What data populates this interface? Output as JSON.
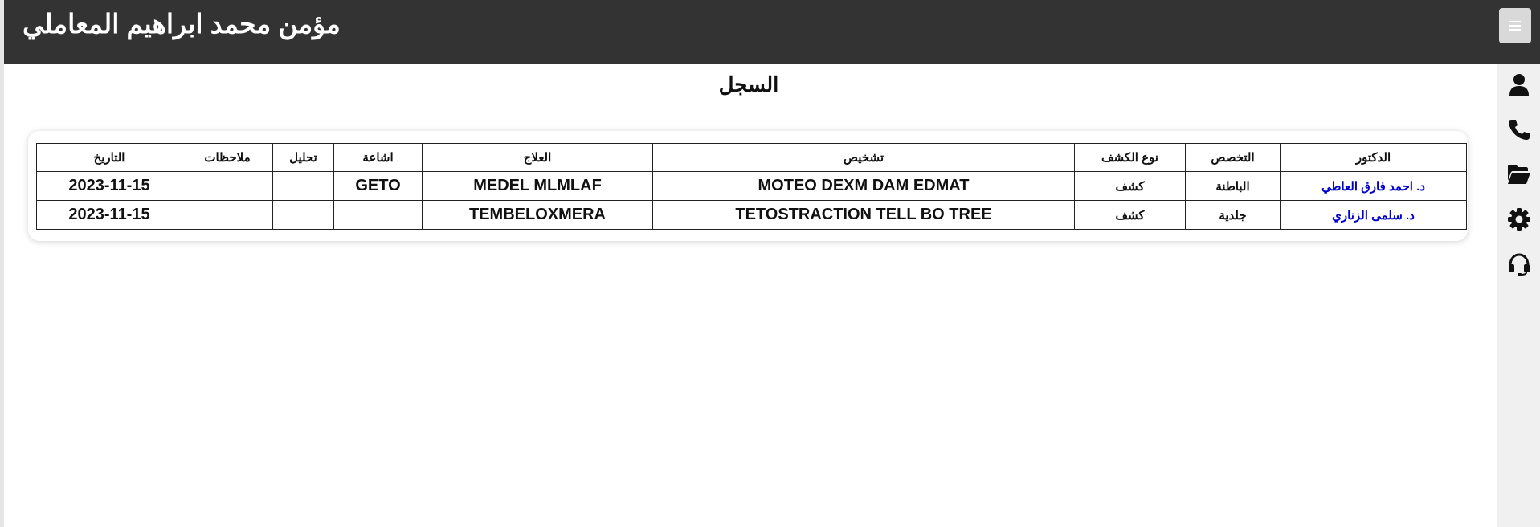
{
  "header": {
    "patient_name": "مؤمن محمد ابراهيم المعاملي",
    "menu_icon": "hamburger-menu-icon"
  },
  "sidebar": {
    "items": [
      {
        "icon": "user-icon"
      },
      {
        "icon": "phone-icon"
      },
      {
        "icon": "folder-open-icon"
      },
      {
        "icon": "gear-icon"
      },
      {
        "icon": "headset-icon"
      }
    ]
  },
  "page": {
    "title": "السجل"
  },
  "records": {
    "columns": [
      "الدكتور",
      "التخصص",
      "نوع الكشف",
      "تشخيص",
      "العلاج",
      "اشاعة",
      "تحليل",
      "ملاحظات",
      "التاريخ"
    ],
    "rows": [
      {
        "doctor": "د. احمد فارق العاطي",
        "specialty": "الباطنة",
        "visit_type": "كشف",
        "diagnosis": "MOTEO DEXM DAM EDMAT",
        "treatment": "MEDEL MLMLAF",
        "xray": "GETO",
        "analysis": "",
        "notes": "",
        "date": "2023-11-15"
      },
      {
        "doctor": "د. سلمى الزناري",
        "specialty": "جلدية",
        "visit_type": "كشف",
        "diagnosis": "TETOSTRACTION TELL BO TREE",
        "treatment": "TEMBELOXMERA",
        "xray": "",
        "analysis": "",
        "notes": "",
        "date": "2023-11-15"
      }
    ]
  },
  "colors": {
    "topbar": "#333333",
    "sidebar": "#f0f0f0",
    "doctor_link": "#0000cc"
  }
}
